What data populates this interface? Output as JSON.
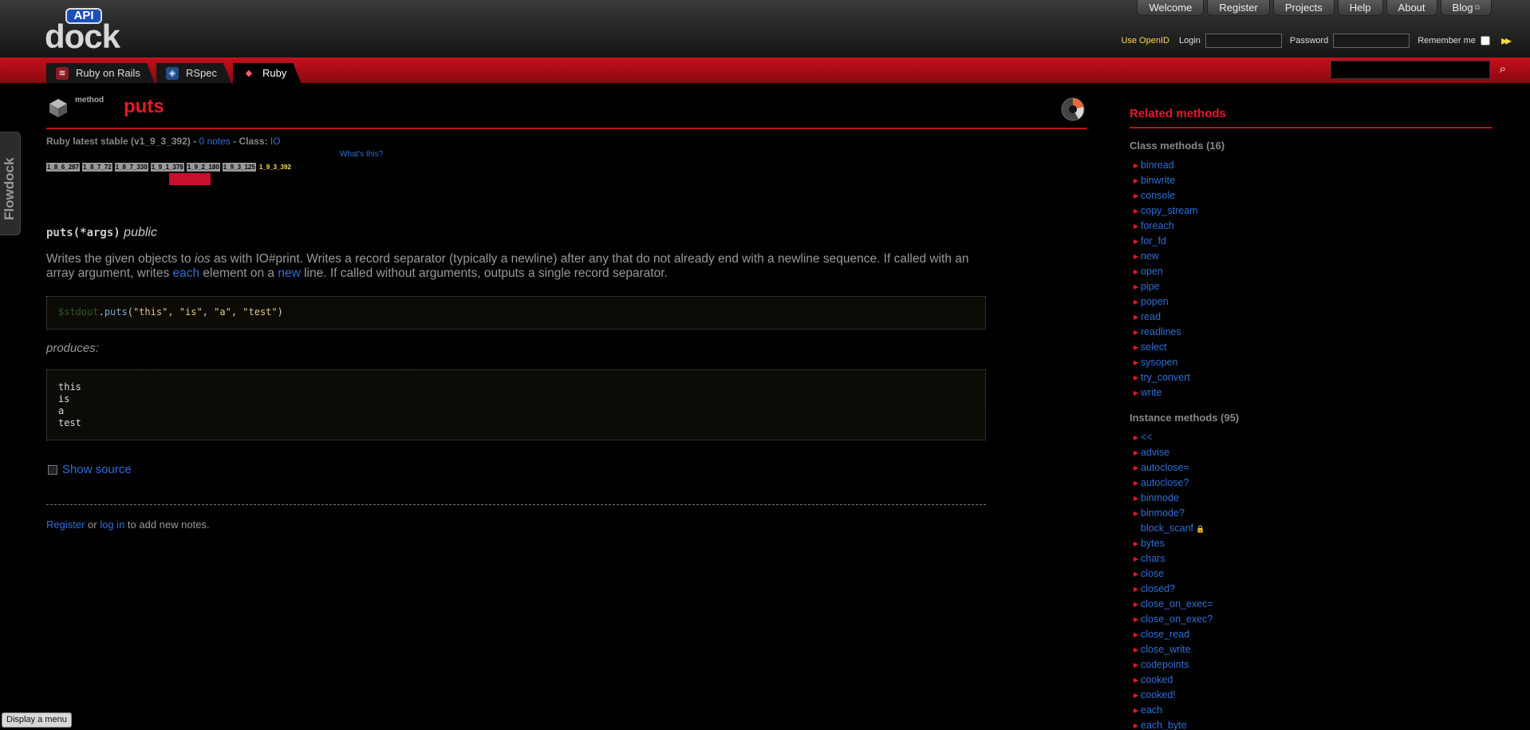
{
  "logo": {
    "api": "API",
    "dock": "dock"
  },
  "topnav": [
    "Welcome",
    "Register",
    "Projects",
    "Help",
    "About",
    "Blog"
  ],
  "topnav_blog_ext": "⧉",
  "login": {
    "openid": "Use OpenID",
    "login_label": "Login",
    "password_label": "Password",
    "remember_label": "Remember me",
    "go": "▸▸"
  },
  "tabs": [
    {
      "label": "Ruby on Rails",
      "icon": "rails-icon",
      "color": "#c8102e"
    },
    {
      "label": "RSpec",
      "icon": "rspec-icon",
      "color": "#3a7bd5"
    },
    {
      "label": "Ruby",
      "icon": "ruby-icon",
      "color": "#e8182b"
    }
  ],
  "flowdock": "Flowdock",
  "method": {
    "type": "method",
    "title": "puts",
    "meta_prefix": "Ruby latest stable (v1_9_3_392) - ",
    "notes_link": "0 notes",
    "meta_mid": " - Class: ",
    "class_link": "IO",
    "whats_this": "What's this?",
    "versions": [
      "1_8_6_287",
      "1_8_7_72",
      "1_8_7_330",
      "1_9_1_378",
      "1_9_2_180",
      "1_9_3_125",
      "1_9_3_392"
    ],
    "signature": "puts(*args)",
    "visibility": "public",
    "desc_1": "Writes the given objects to ",
    "desc_ios": "ios",
    "desc_2": " as with IO#print. Writes a record separator (typically a newline) after any that do not already end with a newline sequence. If called with an array argument, writes ",
    "desc_each": "each",
    "desc_3": " element on a ",
    "desc_new": "new",
    "desc_4": " line. If called without arguments, outputs a single record separator.",
    "code_gv": "$stdout",
    "code_dot": ".",
    "code_method": "puts",
    "code_open": "(",
    "code_args": [
      "\"this\"",
      "\"is\"",
      "\"a\"",
      "\"test\""
    ],
    "code_sep": ", ",
    "code_close": ")",
    "produces": "produces:",
    "output": "this\nis\na\ntest",
    "show_source": "Show source",
    "notes_register": "Register",
    "notes_or": " or ",
    "notes_login": "log in",
    "notes_rest": " to add new notes."
  },
  "sidebar": {
    "title": "Related methods",
    "class_head": "Class methods (16)",
    "class_methods": [
      "binread",
      "binwrite",
      "console",
      "copy_stream",
      "foreach",
      "for_fd",
      "new",
      "open",
      "pipe",
      "popen",
      "read",
      "readlines",
      "select",
      "sysopen",
      "try_convert",
      "write"
    ],
    "instance_head": "Instance methods (95)",
    "instance_methods": [
      "<<",
      "advise",
      "autoclose=",
      "autoclose?",
      "binmode",
      "binmode?",
      "block_scanf",
      "bytes",
      "chars",
      "close",
      "closed?",
      "close_on_exec=",
      "close_on_exec?",
      "close_read",
      "close_write",
      "codepoints",
      "cooked",
      "cooked!",
      "each",
      "each_byte"
    ],
    "locked": [
      "block_scanf"
    ],
    "lock_icon": "🔒"
  },
  "display_menu": "Display a menu",
  "colors": {
    "accent": "#e8182b",
    "link": "#2f6fd6",
    "tabbar": "#c4101c",
    "current_version": "#ffe04a"
  }
}
